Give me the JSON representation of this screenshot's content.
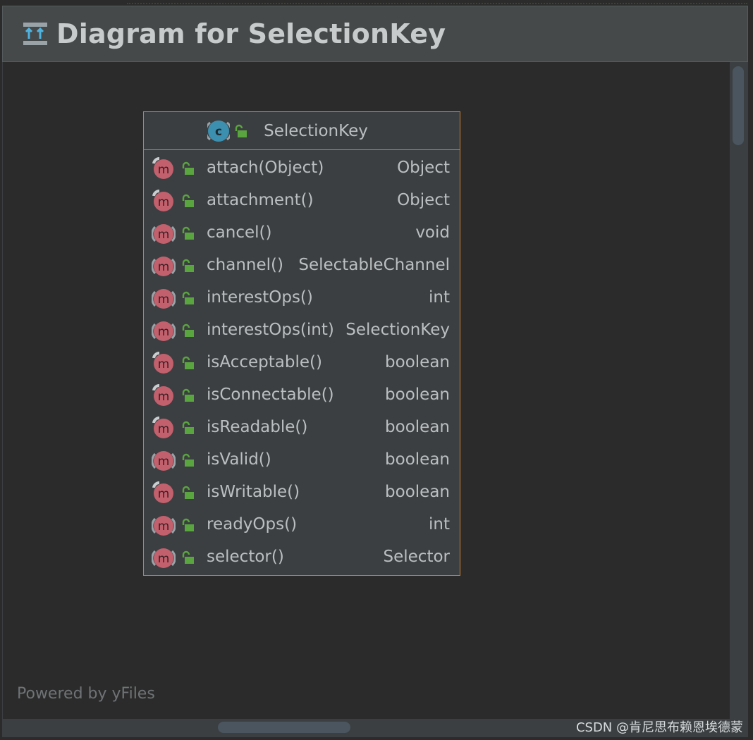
{
  "window": {
    "title": "Diagram for SelectionKey"
  },
  "node": {
    "kind_icon": "class-icon",
    "class_name": "SelectionKey",
    "visibility_icon": "public-lock-icon",
    "members": [
      {
        "name": "attach(Object)",
        "type": "Object",
        "icon": "abstract-method-icon"
      },
      {
        "name": "attachment()",
        "type": "Object",
        "icon": "abstract-method-icon"
      },
      {
        "name": "cancel()",
        "type": "void",
        "icon": "method-icon"
      },
      {
        "name": "channel()",
        "type": "SelectableChannel",
        "icon": "method-icon"
      },
      {
        "name": "interestOps()",
        "type": "int",
        "icon": "method-icon"
      },
      {
        "name": "interestOps(int)",
        "type": "SelectionKey",
        "icon": "method-icon"
      },
      {
        "name": "isAcceptable()",
        "type": "boolean",
        "icon": "abstract-method-icon"
      },
      {
        "name": "isConnectable()",
        "type": "boolean",
        "icon": "abstract-method-icon"
      },
      {
        "name": "isReadable()",
        "type": "boolean",
        "icon": "abstract-method-icon"
      },
      {
        "name": "isValid()",
        "type": "boolean",
        "icon": "method-icon"
      },
      {
        "name": "isWritable()",
        "type": "boolean",
        "icon": "abstract-method-icon"
      },
      {
        "name": "readyOps()",
        "type": "int",
        "icon": "method-icon"
      },
      {
        "name": "selector()",
        "type": "Selector",
        "icon": "method-icon"
      }
    ]
  },
  "footer": {
    "powered_by": "Powered by yFiles"
  },
  "watermark": "CSDN @肯尼思布赖恩埃德蒙",
  "colors": {
    "node_border": "#c9803a",
    "method_icon": "#c2606d",
    "public_lock": "#5aa540",
    "class_icon": "#3d8fb0"
  }
}
